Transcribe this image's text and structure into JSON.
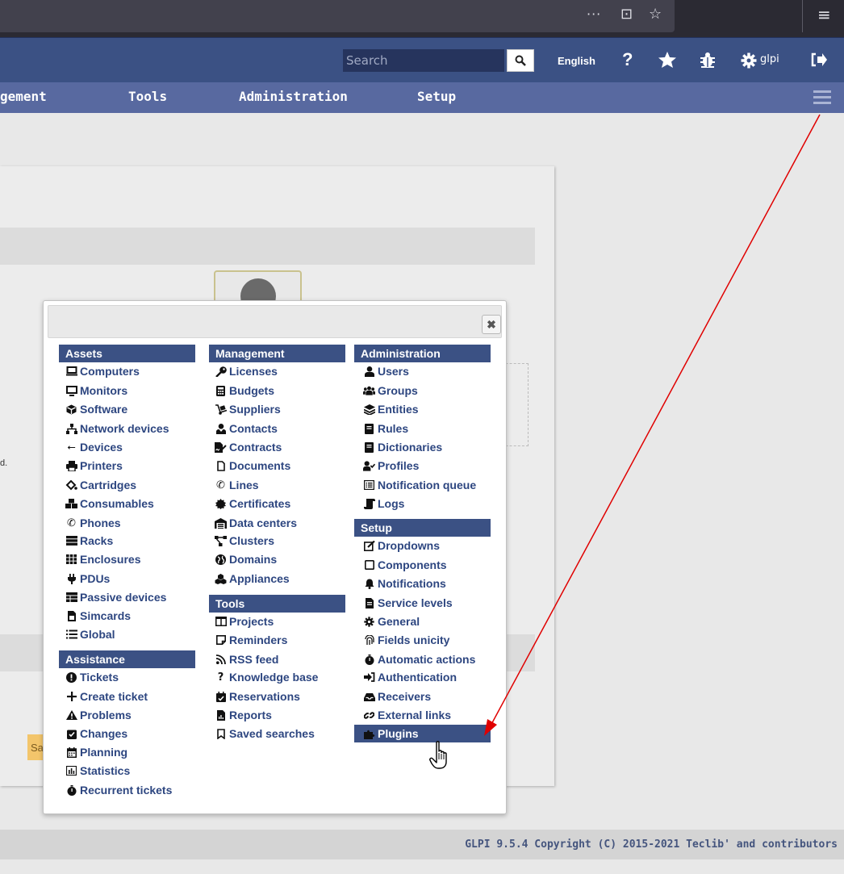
{
  "browser": {
    "more_glyph": "···",
    "pocket_glyph": "⊡",
    "star_glyph": "☆",
    "menu_glyph": "≡"
  },
  "header": {
    "search_placeholder": "Search",
    "language": "English",
    "help_glyph": "?",
    "user": "glpi"
  },
  "nav": {
    "items": [
      "gement",
      "Tools",
      "Administration",
      "Setup"
    ]
  },
  "page": {
    "stray_text": "d.",
    "save_partial": "Sa"
  },
  "menu": {
    "close_glyph": "✖",
    "assets": {
      "title": "Assets",
      "items": [
        "Computers",
        "Monitors",
        "Software",
        "Network devices",
        "Devices",
        "Printers",
        "Cartridges",
        "Consumables",
        "Phones",
        "Racks",
        "Enclosures",
        "PDUs",
        "Passive devices",
        "Simcards",
        "Global"
      ]
    },
    "assistance": {
      "title": "Assistance",
      "items": [
        "Tickets",
        "Create ticket",
        "Problems",
        "Changes",
        "Planning",
        "Statistics",
        "Recurrent tickets"
      ]
    },
    "management": {
      "title": "Management",
      "items": [
        "Licenses",
        "Budgets",
        "Suppliers",
        "Contacts",
        "Contracts",
        "Documents",
        "Lines",
        "Certificates",
        "Data centers",
        "Clusters",
        "Domains",
        "Appliances"
      ]
    },
    "tools": {
      "title": "Tools",
      "items": [
        "Projects",
        "Reminders",
        "RSS feed",
        "Knowledge base",
        "Reservations",
        "Reports",
        "Saved searches"
      ]
    },
    "administration": {
      "title": "Administration",
      "items": [
        "Users",
        "Groups",
        "Entities",
        "Rules",
        "Dictionaries",
        "Profiles",
        "Notification queue",
        "Logs"
      ]
    },
    "setup": {
      "title": "Setup",
      "items": [
        "Dropdowns",
        "Components",
        "Notifications",
        "Service levels",
        "General",
        "Fields unicity",
        "Automatic actions",
        "Authentication",
        "Receivers",
        "External links",
        "Plugins"
      ],
      "active": "Plugins"
    }
  },
  "footer": {
    "text": "GLPI 9.5.4 Copyright (C) 2015-2021 Teclib' and contributors"
  },
  "colors": {
    "header_bg": "#3b5184",
    "nav_bg": "#5869a0",
    "link": "#2d4680",
    "arrow": "#e00000"
  }
}
